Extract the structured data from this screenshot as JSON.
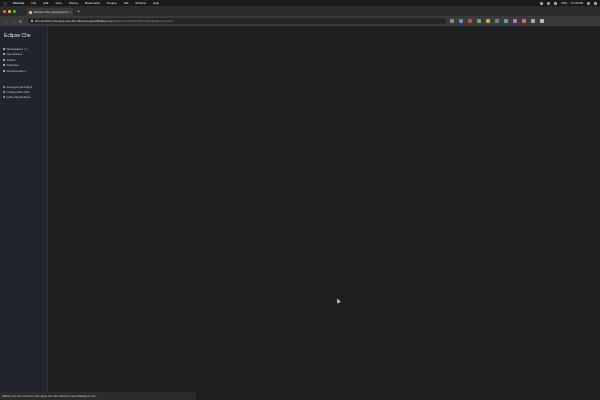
{
  "menubar": {
    "apple_icon": "apple-icon",
    "items": [
      "Chrome",
      "File",
      "Edit",
      "View",
      "History",
      "Bookmarks",
      "People",
      "Tab",
      "Window",
      "Help"
    ],
    "battery": "76%",
    "clock": "Fri 09:58"
  },
  "browser": {
    "tab_title": "Eclipse Che | javacypmyfa...",
    "tab_close": "×",
    "new_tab": "+",
    "url_host": "che-tomfrom-che.apps.che-dev.x6e0.p1.openshiftapps.com",
    "url_path": "/dashboard/#/ide/dslfmnsljdkfja/javacypmyfa",
    "back": "←",
    "forward": "→",
    "reload": "↻"
  },
  "sidebar": {
    "brand": "Eclipse Che",
    "nav": [
      {
        "label": "Workspaces",
        "count": "(1)"
      },
      {
        "label": "Get Started",
        "count": ""
      },
      {
        "label": "Stacks",
        "count": ""
      },
      {
        "label": "Factories",
        "count": ""
      },
      {
        "label": "Administration",
        "count": ""
      }
    ],
    "recent_label": "RECENT WORKSPACES",
    "recent": [
      {
        "label": "javacypmyfa-hq6ya"
      },
      {
        "label": "nodejs-q3tsf-nhfa"
      },
      {
        "label": "python3ypdmfhea"
      }
    ]
  },
  "statusbar": {
    "text": "Waiting for che-tomfrom-che.apps.che-dev.x6e0.p1.openshiftapps.com..."
  },
  "colors": {
    "close": "#ff5f57",
    "minimize": "#febc2e",
    "maximize": "#28c840",
    "sidebar_bg": "#21252b",
    "main_bg": "#1e1e1e"
  }
}
